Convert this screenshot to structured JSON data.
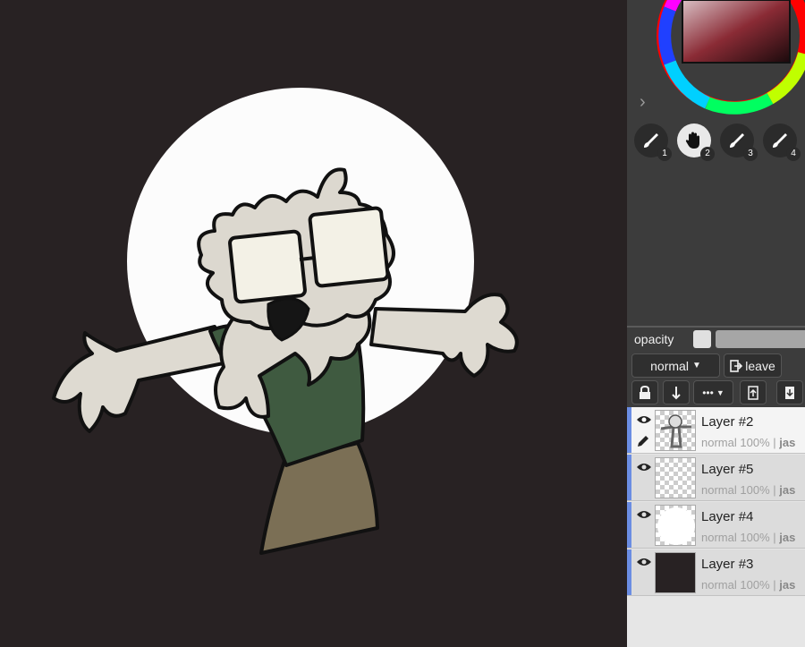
{
  "colors": {
    "canvas_bg": "#282223",
    "panel_bg": "#3c3c3c",
    "accent": "#6b8de3"
  },
  "tools": [
    {
      "num": "1",
      "icon": "brush-icon",
      "active": false
    },
    {
      "num": "2",
      "icon": "hand-icon",
      "active": true
    },
    {
      "num": "3",
      "icon": "brush-icon",
      "active": false
    },
    {
      "num": "4",
      "icon": "brush-icon",
      "active": false
    }
  ],
  "layer_controls": {
    "opacity_label": "opacity",
    "blend_mode": "normal",
    "leave_label": "leave",
    "more_label": "•••"
  },
  "layers": [
    {
      "name": "Layer #2",
      "mode": "normal",
      "opacity": "100%",
      "owner": "jas",
      "selected": true
    },
    {
      "name": "Layer #5",
      "mode": "normal",
      "opacity": "100%",
      "owner": "jas",
      "selected": false
    },
    {
      "name": "Layer #4",
      "mode": "normal",
      "opacity": "100%",
      "owner": "jas",
      "selected": false
    },
    {
      "name": "Layer #3",
      "mode": "normal",
      "opacity": "100%",
      "owner": "jas",
      "selected": false
    }
  ],
  "meta_separator": "|"
}
